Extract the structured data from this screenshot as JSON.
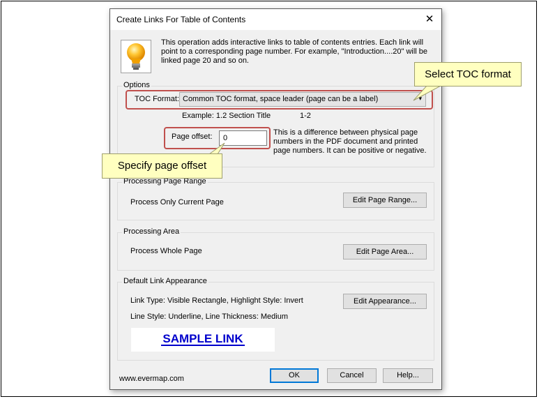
{
  "dialog": {
    "title": "Create Links For Table of Contents",
    "close_glyph": "✕",
    "intro_text": "This operation adds interactive links to table of contents entries. Each link will point to a corresponding page number. For example, \"Introduction....20\" will be linked page 20 and so on."
  },
  "options": {
    "group_label": "Options",
    "toc_format_label": "TOC Format:",
    "toc_format_value": "Common TOC format, space leader (page can be a label)",
    "example_label": "Example: 1.2 Section Title",
    "example_page": "1-2",
    "page_offset_label": "Page offset:",
    "page_offset_value": "0",
    "page_offset_help": "This is a difference between physical page numbers in the PDF document and printed page numbers. It can be positive or negative."
  },
  "page_range": {
    "group_label": "Processing Page Range",
    "value": "Process Only Current Page",
    "button": "Edit Page Range..."
  },
  "area": {
    "group_label": "Processing Area",
    "value": "Process Whole Page",
    "button": "Edit Page Area..."
  },
  "appearance": {
    "group_label": "Default Link Appearance",
    "line1": "Link Type: Visible Rectangle, Highlight Style: Invert",
    "line2": "Line Style: Underline, Line Thickness: Medium",
    "button": "Edit Appearance...",
    "sample": "SAMPLE LINK"
  },
  "footer": {
    "website": "www.evermap.com",
    "ok": "OK",
    "cancel": "Cancel",
    "help": "Help..."
  },
  "callouts": {
    "toc": "Select TOC format",
    "offset": "Specify page offset"
  },
  "colors": {
    "highlight_border": "#c0504d",
    "callout_fill": "#ffffc0",
    "sample_link": "#0000cc",
    "default_button_border": "#0078d7"
  }
}
